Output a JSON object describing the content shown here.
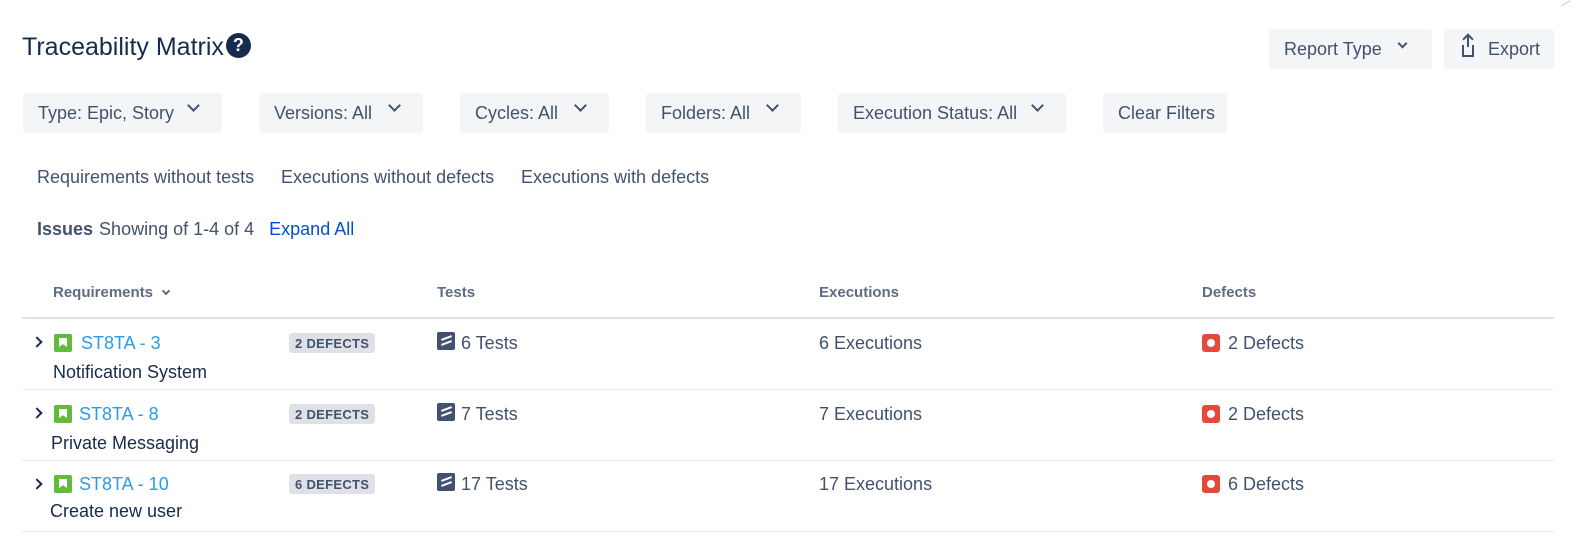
{
  "header": {
    "title": "Traceability Matrix",
    "help_glyph": "?",
    "report_type_label": "Report Type",
    "export_label": "Export"
  },
  "filters": {
    "type": "Type: Epic, Story",
    "versions": "Versions: All",
    "cycles": "Cycles: All",
    "folders": "Folders: All",
    "execution_status": "Execution Status: All",
    "clear": "Clear Filters"
  },
  "quick_filters": {
    "req_without_tests": "Requirements without tests",
    "exec_without_defects": "Executions without defects",
    "exec_with_defects": "Executions with defects"
  },
  "issues": {
    "label": "Issues",
    "showing": "Showing of 1-4 of 4",
    "expand_all": "Expand All"
  },
  "table": {
    "columns": {
      "requirements": "Requirements",
      "tests": "Tests",
      "executions": "Executions",
      "defects": "Defects"
    },
    "rows": [
      {
        "key": "ST8TA - 3",
        "summary": "Notification System",
        "lozenge": "2 DEFECTS",
        "tests": "6 Tests",
        "executions": "6 Executions",
        "defects": "2 Defects"
      },
      {
        "key": "ST8TA - 8",
        "summary": "Private Messaging",
        "lozenge": "2 DEFECTS",
        "tests": "7 Tests",
        "executions": "7 Executions",
        "defects": "2 Defects"
      },
      {
        "key": "ST8TA - 10",
        "summary": "Create new user",
        "lozenge": "6 DEFECTS",
        "tests": "17 Tests",
        "executions": "17 Executions",
        "defects": "6 Defects"
      }
    ]
  },
  "icons": {
    "help": "help-circle-icon",
    "export": "export-icon",
    "chevron": "chevron-down-icon",
    "story": "story-icon",
    "test": "test-icon",
    "bug": "bug-icon"
  },
  "colors": {
    "link": "#0052cc",
    "issue_key": "#2d9be6",
    "story": "#63ba3c",
    "bug": "#e5493a",
    "button_bg": "#f4f5f7"
  }
}
